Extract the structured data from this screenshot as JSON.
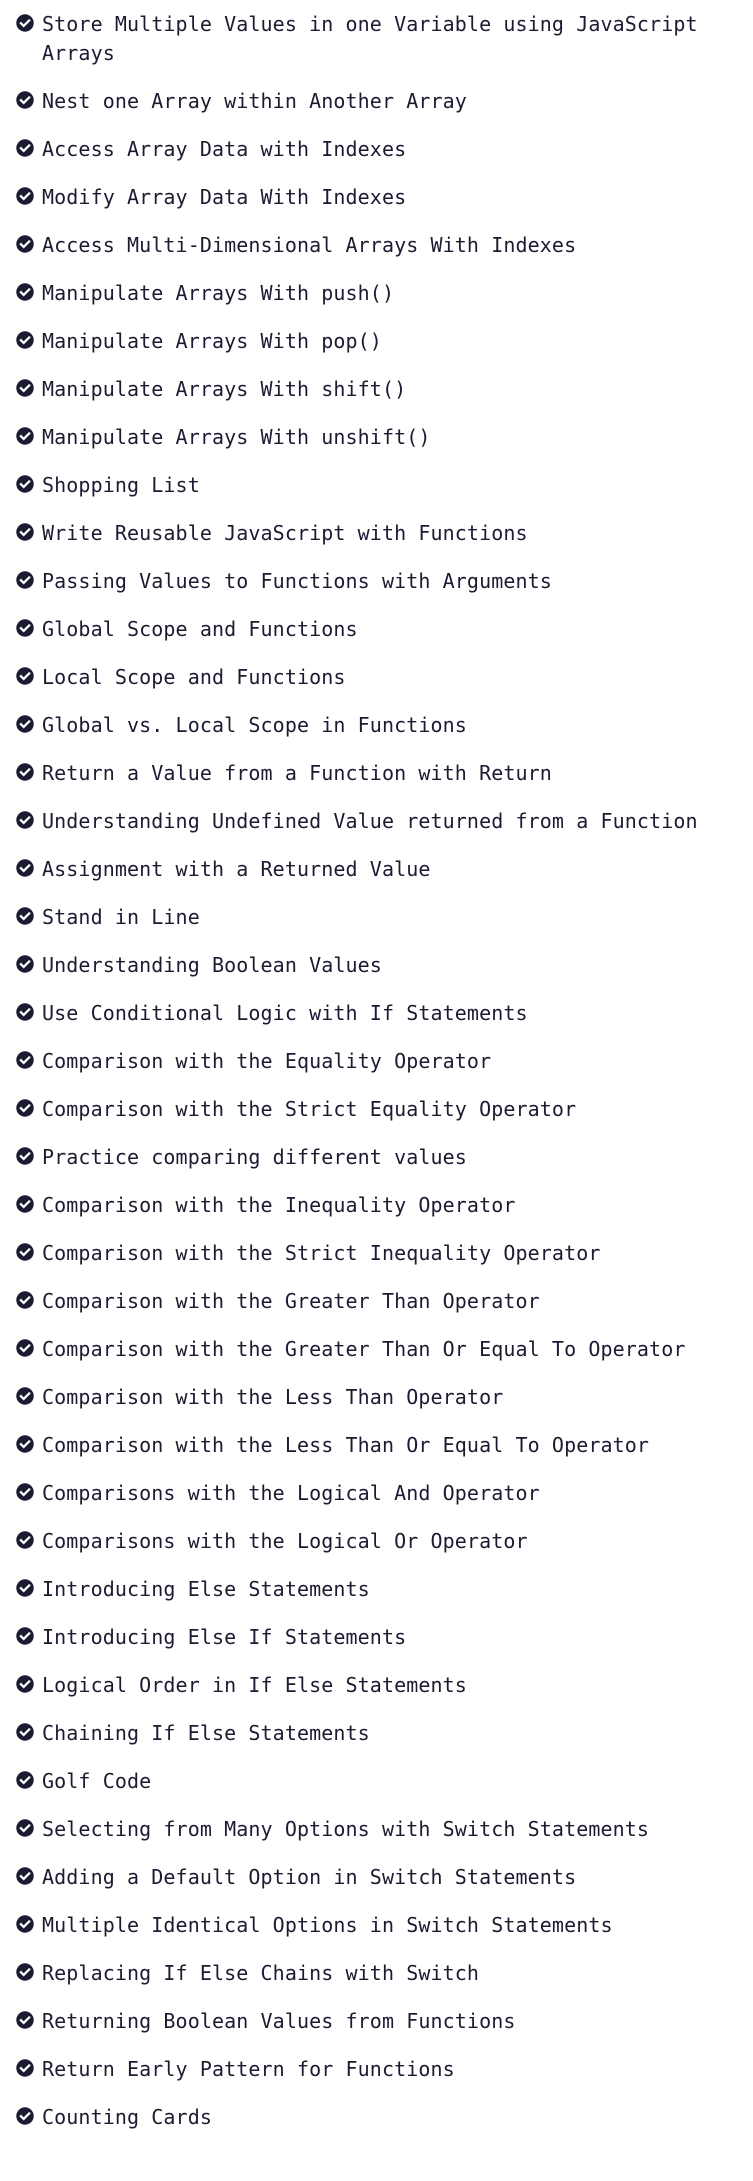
{
  "icon": "check-circle-icon",
  "colors": {
    "text": "#1b1b32",
    "icon": "#1b1b32",
    "background": "#ffffff"
  },
  "challenges": [
    "Store Multiple Values in one Variable using JavaScript Arrays",
    "Nest one Array within Another Array",
    "Access Array Data with Indexes",
    "Modify Array Data With Indexes",
    "Access Multi-Dimensional Arrays With Indexes",
    "Manipulate Arrays With push()",
    "Manipulate Arrays With pop()",
    "Manipulate Arrays With shift()",
    "Manipulate Arrays With unshift()",
    "Shopping List",
    "Write Reusable JavaScript with Functions",
    "Passing Values to Functions with Arguments",
    "Global Scope and Functions",
    "Local Scope and Functions",
    "Global vs. Local Scope in Functions",
    "Return a Value from a Function with Return",
    "Understanding Undefined Value returned from a Function",
    "Assignment with a Returned Value",
    "Stand in Line",
    "Understanding Boolean Values",
    "Use Conditional Logic with If Statements",
    "Comparison with the Equality Operator",
    "Comparison with the Strict Equality Operator",
    "Practice comparing different values",
    "Comparison with the Inequality Operator",
    "Comparison with the Strict Inequality Operator",
    "Comparison with the Greater Than Operator",
    "Comparison with the Greater Than Or Equal To Operator",
    "Comparison with the Less Than Operator",
    "Comparison with the Less Than Or Equal To Operator",
    "Comparisons with the Logical And Operator",
    "Comparisons with the Logical Or Operator",
    "Introducing Else Statements",
    "Introducing Else If Statements",
    "Logical Order in If Else Statements",
    "Chaining If Else Statements",
    "Golf Code",
    "Selecting from Many Options with Switch Statements",
    "Adding a Default Option in Switch Statements",
    "Multiple Identical Options in Switch Statements",
    "Replacing If Else Chains with Switch",
    "Returning Boolean Values from Functions",
    "Return Early Pattern for Functions",
    "Counting Cards"
  ]
}
